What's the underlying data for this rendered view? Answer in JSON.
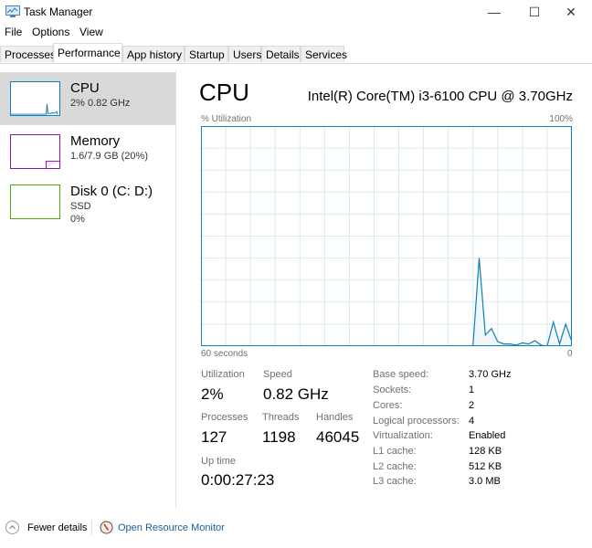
{
  "window": {
    "title": "Task Manager",
    "controls": {
      "minimize": "—",
      "maximize": "☐",
      "close": "✕"
    }
  },
  "menu": [
    "File",
    "Options",
    "View"
  ],
  "tabs": [
    {
      "label": "Processes",
      "active": false
    },
    {
      "label": "Performance",
      "active": true
    },
    {
      "label": "App history",
      "active": false
    },
    {
      "label": "Startup",
      "active": false
    },
    {
      "label": "Users",
      "active": false
    },
    {
      "label": "Details",
      "active": false
    },
    {
      "label": "Services",
      "active": false
    }
  ],
  "sidebar": {
    "items": [
      {
        "title": "CPU",
        "line1": "2%  0.82 GHz",
        "line2": "",
        "color": "#117dbb",
        "selected": true
      },
      {
        "title": "Memory",
        "line1": "1.6/7.9 GB (20%)",
        "line2": "",
        "color": "#8b12ae",
        "selected": false
      },
      {
        "title": "Disk 0 (C: D:)",
        "line1": "SSD",
        "line2": "0%",
        "color": "#4da60c",
        "selected": false
      }
    ]
  },
  "main": {
    "title": "CPU",
    "cpu_model": "Intel(R) Core(TM) i3-6100 CPU @ 3.70GHz",
    "graph_label_left": "% Utilization",
    "graph_label_right": "100%",
    "graph_footer_left": "60 seconds",
    "graph_footer_right": "0",
    "stats": {
      "utilization": {
        "label": "Utilization",
        "value": "2%"
      },
      "speed": {
        "label": "Speed",
        "value": "0.82 GHz"
      },
      "processes": {
        "label": "Processes",
        "value": "127"
      },
      "threads": {
        "label": "Threads",
        "value": "1198"
      },
      "handles": {
        "label": "Handles",
        "value": "46045"
      },
      "uptime": {
        "label": "Up time",
        "value": "0:00:27:23"
      }
    },
    "specs": [
      {
        "key": "Base speed:",
        "value": "3.70 GHz"
      },
      {
        "key": "Sockets:",
        "value": "1"
      },
      {
        "key": "Cores:",
        "value": "2"
      },
      {
        "key": "Logical processors:",
        "value": "4"
      },
      {
        "key": "Virtualization:",
        "value": "Enabled"
      },
      {
        "key": "L1 cache:",
        "value": "128 KB"
      },
      {
        "key": "L2 cache:",
        "value": "512 KB"
      },
      {
        "key": "L3 cache:",
        "value": "3.0 MB"
      }
    ]
  },
  "footer": {
    "fewer_details": "Fewer details",
    "open_resource_monitor": "Open Resource Monitor"
  },
  "chart_data": {
    "type": "area",
    "title": "CPU % Utilization",
    "xlabel": "60 seconds",
    "ylabel": "% Utilization",
    "ylim": [
      0,
      100
    ],
    "xlim": [
      60,
      0
    ],
    "grid": true,
    "color": "#117dbb",
    "seconds_ago": [
      16,
      15,
      14,
      13,
      12,
      11,
      10,
      9,
      8,
      7,
      6,
      5,
      4,
      3,
      2,
      1,
      0
    ],
    "values": [
      0,
      40,
      5,
      8,
      2,
      1,
      1,
      0.5,
      1.5,
      1,
      2.5,
      0.5,
      0,
      11,
      1,
      10,
      2
    ]
  }
}
